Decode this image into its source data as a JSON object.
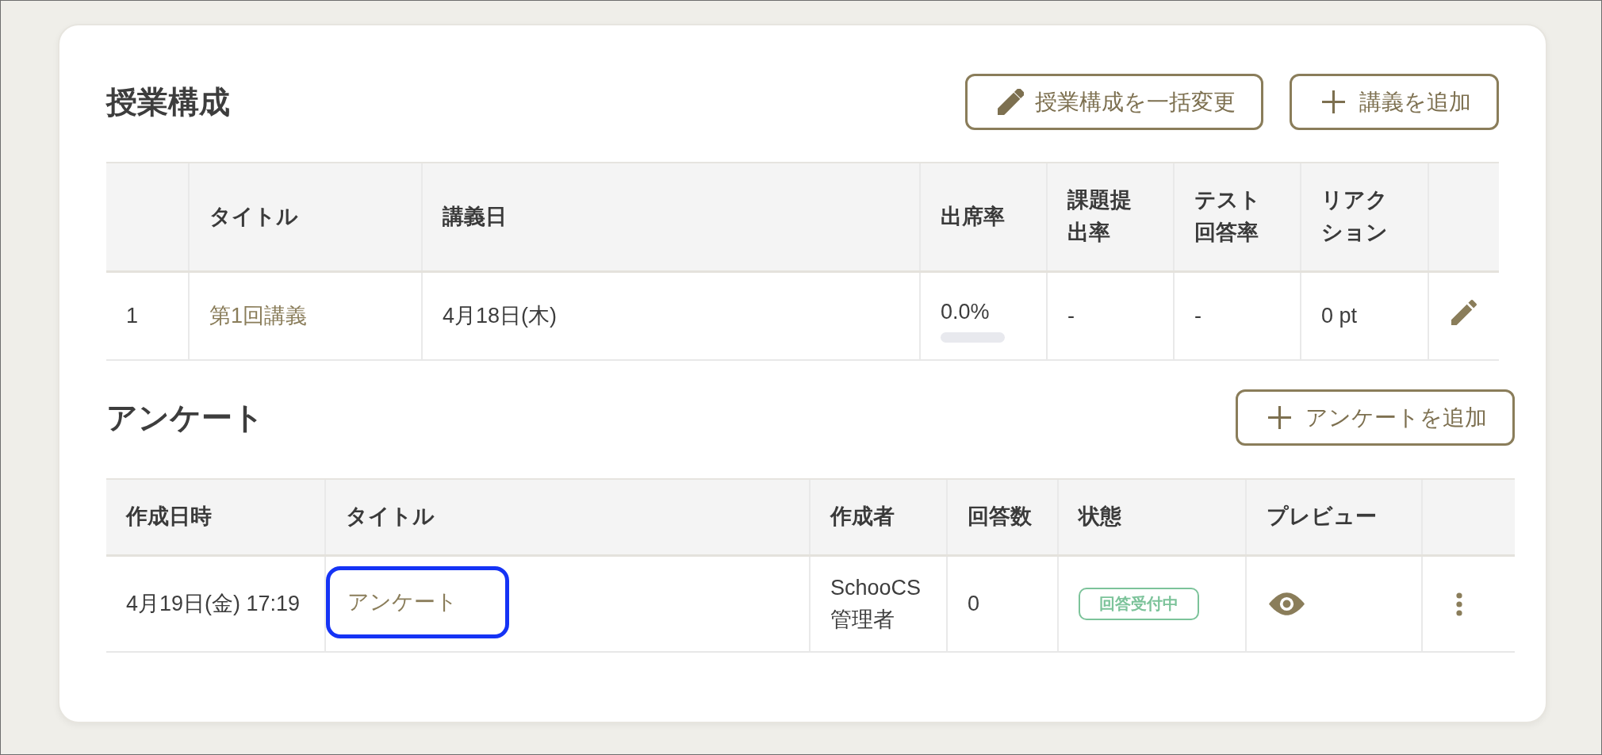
{
  "course_structure": {
    "title": "授業構成",
    "buttons": [
      {
        "kind": "edit",
        "label": "授業構成を一括変更"
      },
      {
        "kind": "add",
        "label": "講義を追加"
      }
    ],
    "table": {
      "columns": [
        "タイトル",
        "講義日",
        "出席率",
        "課題提出率",
        "テスト回答率",
        "リアクション"
      ],
      "rows": [
        {
          "number": "1",
          "title": "第1回講義",
          "date": "4月18日(木)",
          "attendance": {
            "reading": "0.0%",
            "level": 0
          },
          "assignment_rate": "-",
          "test_rate": "-",
          "reaction": "0 pt"
        }
      ]
    }
  },
  "survey": {
    "title": "アンケート",
    "buttons": [
      {
        "kind": "add",
        "label": "アンケートを追加"
      }
    ],
    "table": {
      "columns": [
        "作成日時",
        "タイトル",
        "作成者",
        "回答数",
        "状態",
        "プレビュー"
      ],
      "rows": [
        {
          "created": "4月19日(金) 17:19",
          "title": "アンケート",
          "highlighted": true,
          "author": "SchooCS 管理者",
          "responses": "0",
          "status": {
            "label": "回答受付中",
            "color": "#7cc39a"
          }
        }
      ]
    }
  }
}
